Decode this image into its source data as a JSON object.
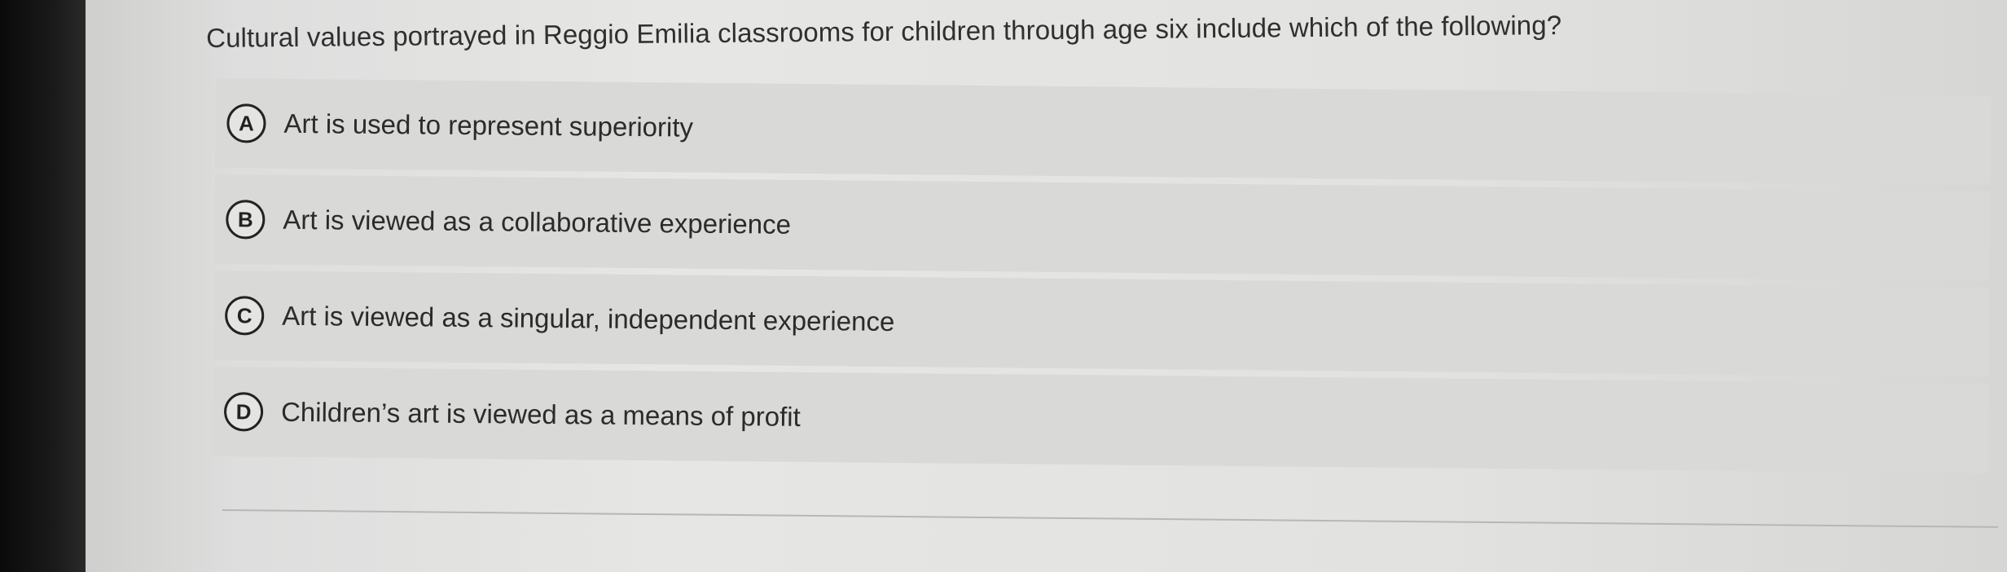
{
  "question": {
    "text": "Cultural values portrayed in Reggio Emilia classrooms for children through age six include which of the following?"
  },
  "options": [
    {
      "letter": "A",
      "text": "Art is used to represent superiority"
    },
    {
      "letter": "B",
      "text": "Art is viewed as a collaborative experience"
    },
    {
      "letter": "C",
      "text": "Art is viewed as a singular, independent experience"
    },
    {
      "letter": "D",
      "text": "Children’s art is viewed as a means of profit"
    }
  ]
}
